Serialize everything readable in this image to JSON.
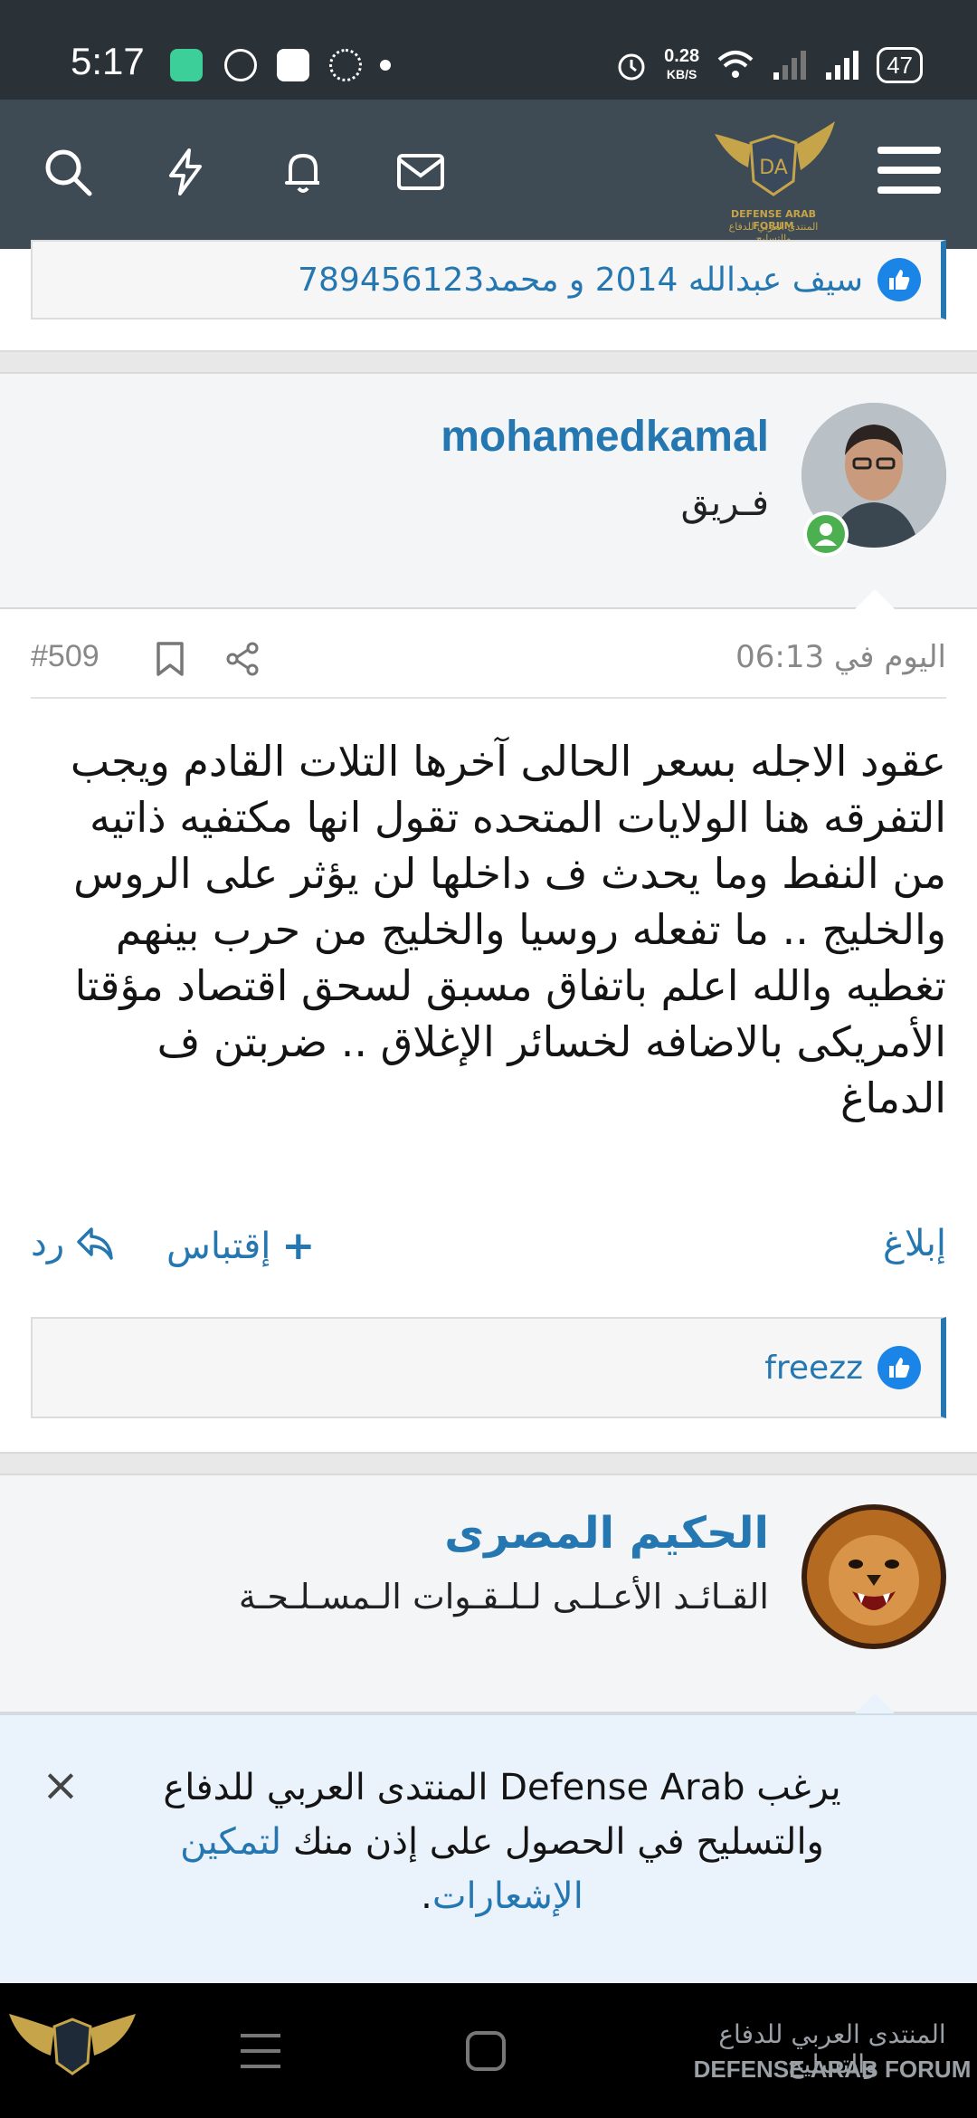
{
  "status_bar": {
    "time": "5:17",
    "net_speed_value": "0.28",
    "net_speed_unit": "KB/S",
    "battery": "47"
  },
  "header": {
    "logo_text_en": "DEFENSE ARAB FORUM",
    "logo_text_ar": "المنتدى العربي للدفاع والتسليح",
    "icons": [
      "search-icon",
      "flash-icon",
      "bell-icon",
      "mail-icon",
      "menu-icon"
    ]
  },
  "prev_post": {
    "reactions_text": "سيف عبدالله 2014 و محمد789456123"
  },
  "post": {
    "author": "mohamedkamal",
    "user_title": "فـريق",
    "date": "اليوم في 06:13",
    "number": "#509",
    "body": "عقود الاجله بسعر الحالى آخرها التلات القادم ويجب التفرقه هنا الولايات المتحده تقول انها مكتفيه ذاتيه من النفط وما يحدث ف داخلها لن يؤثر على الروس والخليج .. ما تفعله روسيا والخليج من حرب بينهم تغطيه والله اعلم باتفاق مسبق لسحق اقتصاد مؤقتا الأمريكى بالاضافه لخسائر الإغلاق .. ضربتن ف الدماغ",
    "actions": {
      "report": "إبلاغ",
      "quote": "إقتباس",
      "reply": "رد"
    },
    "reactions_text": "freezz"
  },
  "next_post": {
    "author": "الحكيم المصرى",
    "user_title": "القـائـد الأعـلـى لـلـقـوات الـمسـلـحـة"
  },
  "notification": {
    "text_before": "يرغب Defense Arab المنتدى العربي للدفاع والتسليح في الحصول على إذن منك ",
    "link": "لتمكين الإشعارات",
    "text_after": ".",
    "close": "×"
  },
  "watermark": {
    "ar": "المنتدى العربي للدفاع والتسليح",
    "en": "DEFENSE ARAB FORUM"
  },
  "colors": {
    "accent": "#2577b1",
    "header_bg": "#34404b",
    "like_blue": "#1b84e7"
  }
}
